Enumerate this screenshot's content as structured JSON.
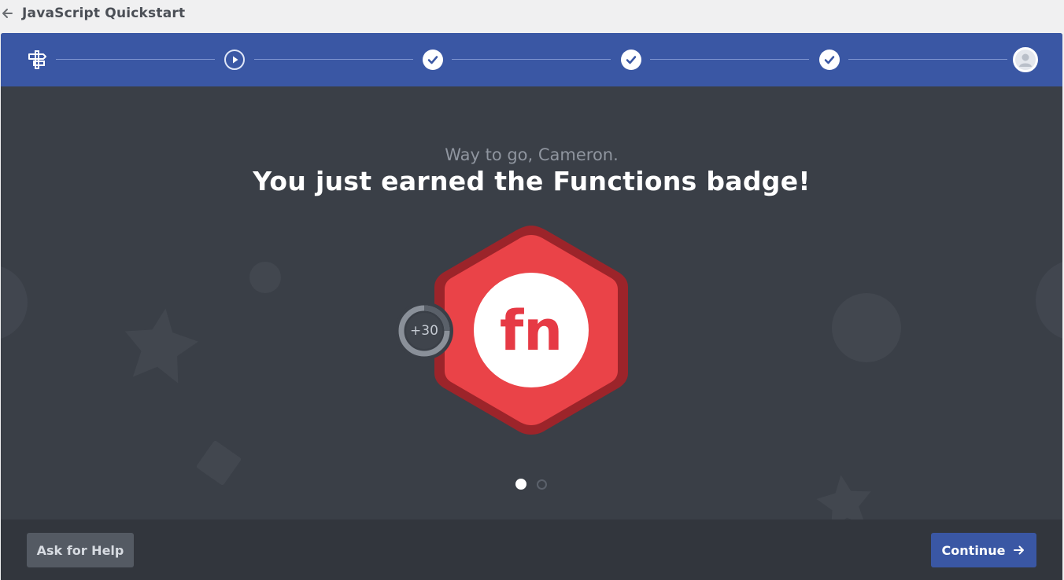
{
  "header": {
    "back_icon": "arrow-left-icon",
    "title": "JavaScript Quickstart"
  },
  "progress": {
    "steps": [
      {
        "icon": "signpost-icon"
      },
      {
        "icon": "play-icon"
      },
      {
        "icon": "check-icon"
      },
      {
        "icon": "check-icon"
      },
      {
        "icon": "check-icon"
      },
      {
        "icon": "user-avatar-icon"
      }
    ]
  },
  "celebration": {
    "subtitle": "Way to go, Cameron.",
    "headline": "You just earned the Functions badge!",
    "badge_label": "fn",
    "points": "+30"
  },
  "pager": {
    "count": 2,
    "active_index": 0
  },
  "footer": {
    "help_label": "Ask for Help",
    "continue_label": "Continue"
  },
  "colors": {
    "progress_bar": "#3a57a4",
    "stage_bg": "#3a3f47",
    "badge_red": "#ea4348",
    "badge_dark_red": "#9c242a"
  }
}
